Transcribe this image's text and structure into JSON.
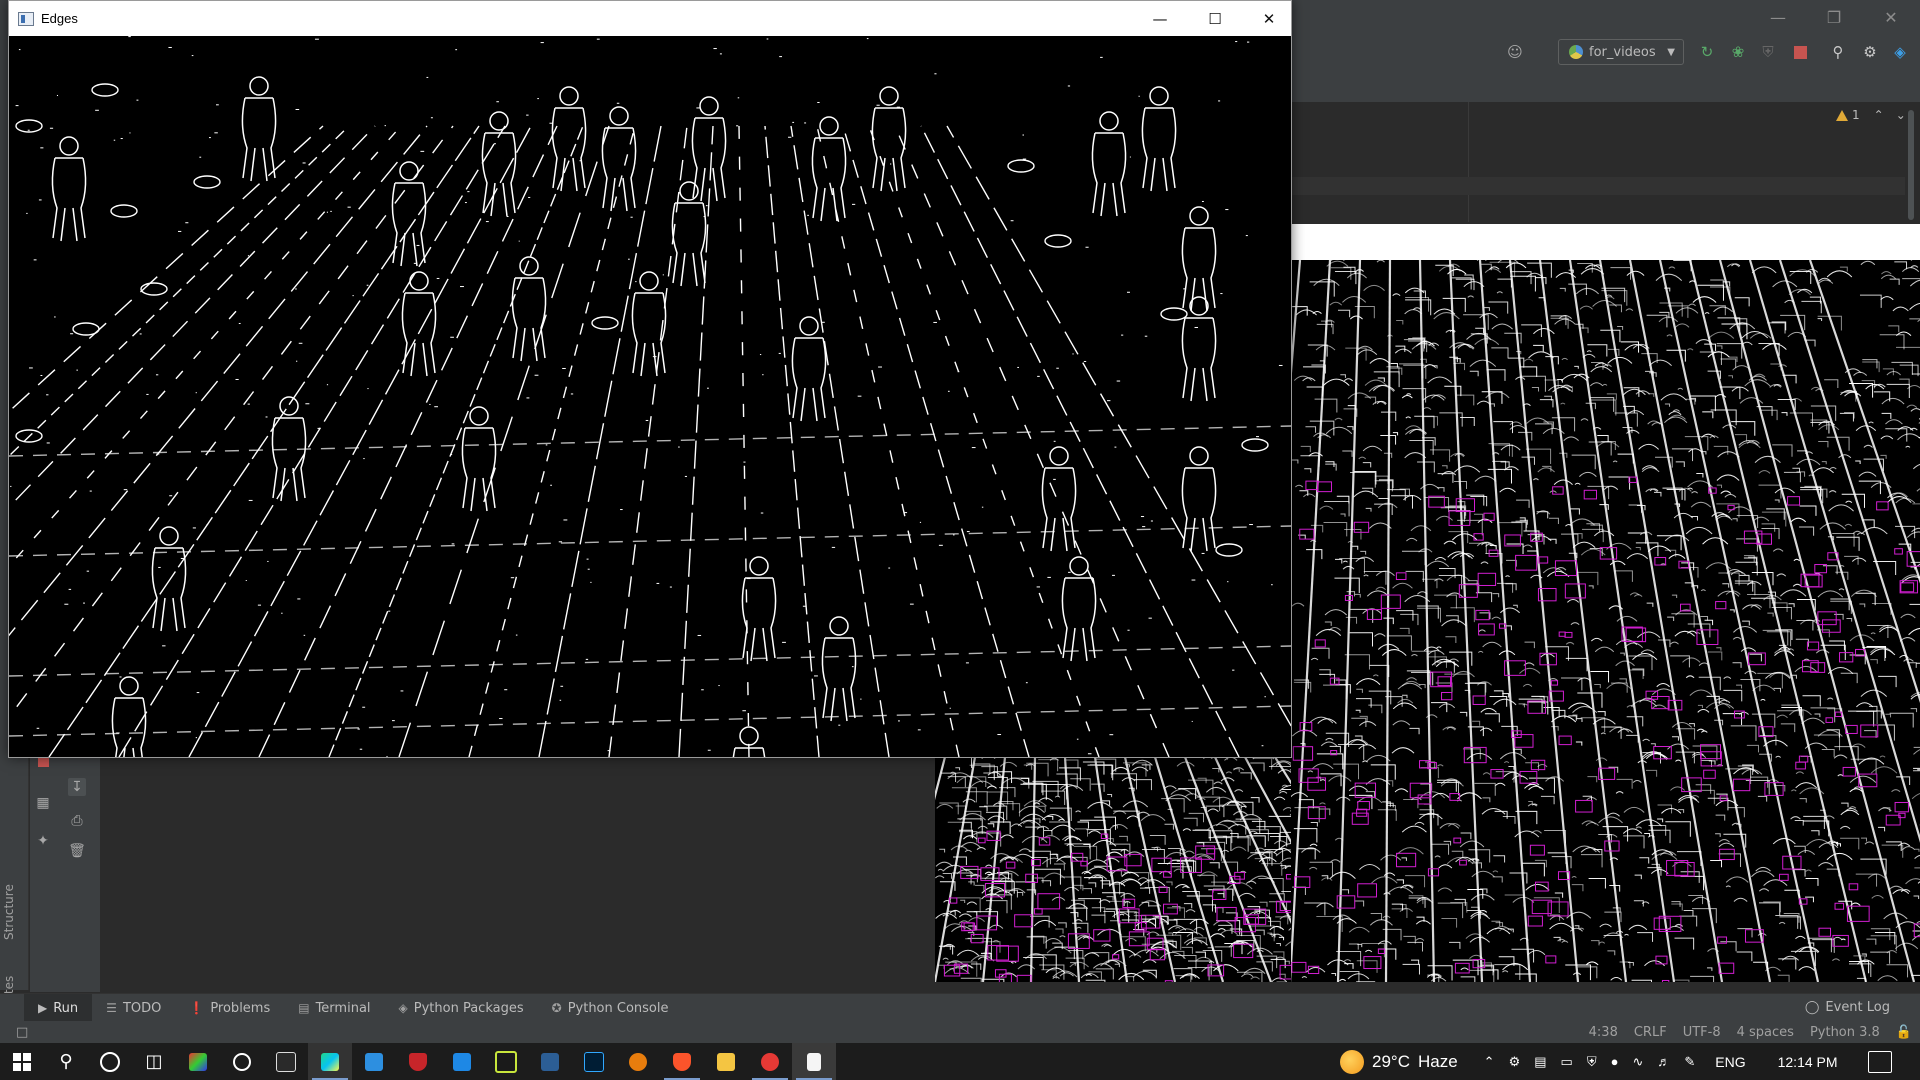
{
  "ide": {
    "run_config": "for_videos",
    "inspection_count": "1",
    "tool_windows": [
      {
        "label": "Run",
        "icon": "run-icon"
      },
      {
        "label": "TODO",
        "icon": "list-icon"
      },
      {
        "label": "Problems",
        "icon": "problems-icon"
      },
      {
        "label": "Terminal",
        "icon": "terminal-icon"
      },
      {
        "label": "Python Packages",
        "icon": "packages-icon"
      },
      {
        "label": "Python Console",
        "icon": "python-icon"
      }
    ],
    "event_log": "Event Log",
    "side_labels": {
      "structure": "Structure",
      "favorites": "Favorites"
    },
    "status": {
      "position": "4:38",
      "line_sep": "CRLF",
      "encoding": "UTF-8",
      "indent": "4 spaces",
      "interpreter": "Python 3.8"
    }
  },
  "edges_window": {
    "title": "Edges"
  },
  "taskbar": {
    "apps": [
      "start",
      "search",
      "cortana",
      "task-view",
      "app-1",
      "unreal",
      "epic",
      "pycharm",
      "vscode",
      "antivirus",
      "app-blue",
      "pycharm-ce",
      "powershell",
      "photoshop",
      "blender",
      "brave",
      "explorer",
      "app-red",
      "notes"
    ],
    "weather_temp": "29°C",
    "weather_desc": "Haze",
    "language": "ENG",
    "time": "12:14 PM"
  },
  "colors": {
    "ide_bg": "#2b2b2b",
    "ide_panel": "#3c3f41",
    "accent_green": "#59a869",
    "accent_red": "#c75450",
    "canny_edge": "#ffffff",
    "canny_magenta": "#d21ed2"
  }
}
